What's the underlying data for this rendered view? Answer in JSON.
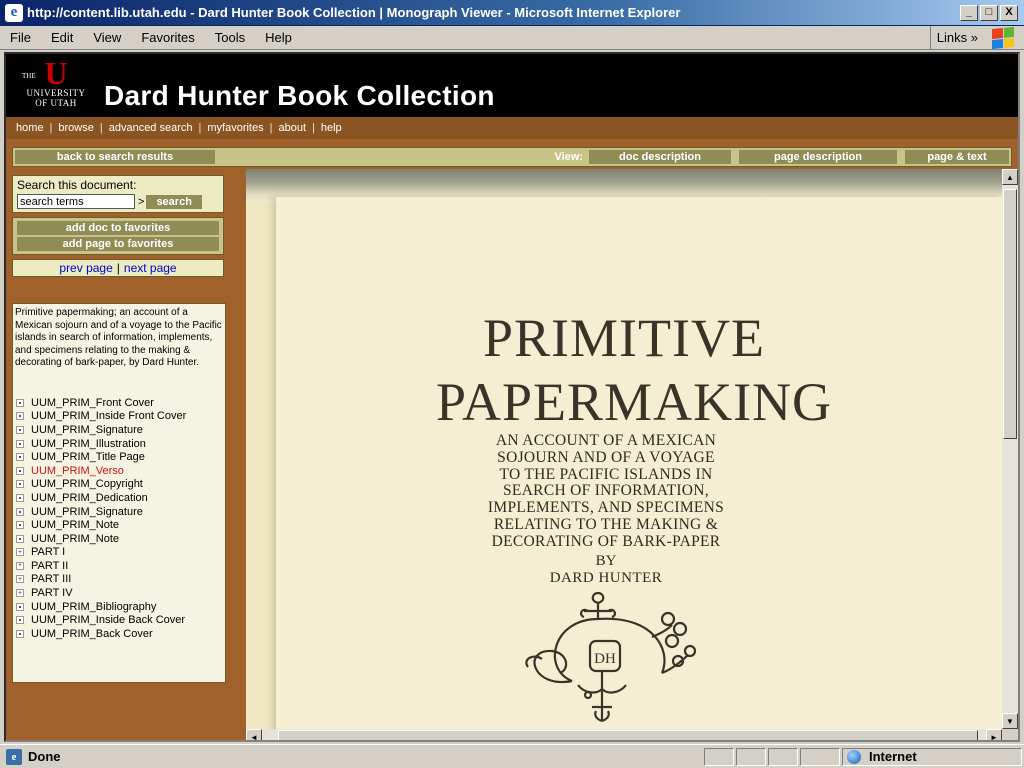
{
  "window": {
    "title": "http://content.lib.utah.edu - Dard Hunter Book Collection | Monograph Viewer - Microsoft Internet Explorer",
    "minimize": "_",
    "maximize": "□",
    "close": "X"
  },
  "menubar": {
    "items": [
      "File",
      "Edit",
      "View",
      "Favorites",
      "Tools",
      "Help"
    ],
    "links_label": "Links »"
  },
  "site": {
    "logo_the": "THE",
    "logo_line1": "UNIVERSITY",
    "logo_line2": "OF UTAH",
    "logo_letter": "U",
    "title": "Dard Hunter Book Collection",
    "nav": [
      "home",
      "browse",
      "advanced search",
      "myfavorites",
      "about",
      "help"
    ]
  },
  "toolbar": {
    "back": "back to search results",
    "view_label": "View:",
    "doc_description": "doc description",
    "page_description": "page description",
    "page_text": "page & text"
  },
  "search": {
    "label": "Search this document:",
    "placeholder": "search terms",
    "value": "search terms",
    "gt": ">",
    "button": "search"
  },
  "favorites": {
    "add_doc": "add doc to favorites",
    "add_page": "add page to favorites"
  },
  "pager": {
    "prev": "prev page",
    "sep": "|",
    "next": "next page"
  },
  "document": {
    "description": "Primitive papermaking; an account of a Mexican sojourn and of a voyage to the Pacific islands in search of information, implements, and specimens relating to the making & decorating of bark-paper, by Dard Hunter.",
    "toc": [
      {
        "label": "UUM_PRIM_Front Cover",
        "marker": "dot",
        "active": false
      },
      {
        "label": "UUM_PRIM_Inside Front Cover",
        "marker": "dot",
        "active": false
      },
      {
        "label": "UUM_PRIM_Signature",
        "marker": "dot",
        "active": false
      },
      {
        "label": "UUM_PRIM_Illustration",
        "marker": "dot",
        "active": false
      },
      {
        "label": "UUM_PRIM_Title Page",
        "marker": "dot",
        "active": false
      },
      {
        "label": "UUM_PRIM_Verso",
        "marker": "dot",
        "active": true
      },
      {
        "label": "UUM_PRIM_Copyright",
        "marker": "dot",
        "active": false
      },
      {
        "label": "UUM_PRIM_Dedication",
        "marker": "dot",
        "active": false
      },
      {
        "label": "UUM_PRIM_Signature",
        "marker": "dot",
        "active": false
      },
      {
        "label": "UUM_PRIM_Note",
        "marker": "dot",
        "active": false
      },
      {
        "label": "UUM_PRIM_Note",
        "marker": "dot",
        "active": false
      },
      {
        "label": "PART I",
        "marker": "+",
        "active": false
      },
      {
        "label": "PART II",
        "marker": "+",
        "active": false
      },
      {
        "label": "PART III",
        "marker": "+",
        "active": false
      },
      {
        "label": "PART IV",
        "marker": "+",
        "active": false
      },
      {
        "label": "UUM_PRIM_Bibliography",
        "marker": "dot",
        "active": false
      },
      {
        "label": "UUM_PRIM_Inside Back Cover",
        "marker": "dot",
        "active": false
      },
      {
        "label": "UUM_PRIM_Back Cover",
        "marker": "dot",
        "active": false
      }
    ]
  },
  "page_image": {
    "title_line1": "PRIMITIVE",
    "title_line2": "PAPERMAKING",
    "subtitle": [
      "AN ACCOUNT OF A MEXICAN",
      "SOJOURN AND OF A VOYAGE",
      "TO THE PACIFIC ISLANDS IN",
      "SEARCH OF INFORMATION,",
      "IMPLEMENTS, AND SPECIMENS",
      "RELATING TO THE MAKING &",
      "DECORATING OF BARK-PAPER"
    ],
    "by": "BY",
    "author": "DARD HUNTER",
    "monogram": "DH"
  },
  "status": {
    "text": "Done",
    "zone": "Internet"
  },
  "colors": {
    "brown_bg": "#a0622a",
    "nav_bg": "#8b5423",
    "button_olive": "#8f8c56",
    "toolbar_bg": "#c8c488",
    "active_item": "#cc1111",
    "utah_red": "#cc0000"
  }
}
